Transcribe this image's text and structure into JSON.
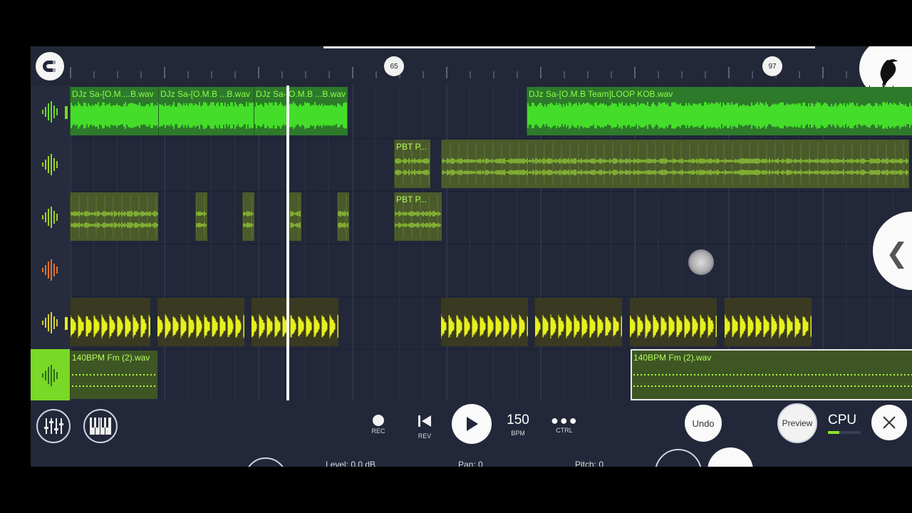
{
  "ruler": {
    "markers": [
      "65",
      "97"
    ]
  },
  "tracks": [
    {
      "icon_color": "#6fd62a",
      "clips": [
        {
          "label": "DJz Sa-[O.M....B.wav",
          "color": "green"
        },
        {
          "label": "DJz Sa-[O.M.B ...B.wav",
          "color": "green"
        },
        {
          "label": "DJz Sa-[O.M.B ...B.wav",
          "color": "green"
        },
        {
          "label": "DJz Sa-[O.M.B Team]LOOP KOB.wav",
          "color": "green"
        }
      ]
    },
    {
      "icon_color": "#9fd02a",
      "clips": [
        {
          "label": "PBT P...",
          "color": "olive"
        },
        {
          "label": "",
          "color": "olive"
        }
      ]
    },
    {
      "icon_color": "#9fd02a",
      "clips": [
        {
          "label": "",
          "color": "olive"
        },
        {
          "label": "PBT P...",
          "color": "olive"
        }
      ]
    },
    {
      "icon_color": "#e0722a",
      "clips": []
    },
    {
      "icon_color": "#d9d02a",
      "clips": []
    },
    {
      "icon_color": "#2f6b1c",
      "clips": [
        {
          "label": "140BPM Fm (2).wav",
          "color": "lime"
        },
        {
          "label": "140BPM Fm (2).wav",
          "color": "lime"
        }
      ]
    }
  ],
  "transport": {
    "rec_label": "REC",
    "rev_label": "REV",
    "bpm_value": "150",
    "bpm_label": "BPM",
    "ctrl_label": "CTRL",
    "undo_label": "Undo",
    "preview_label": "Preview",
    "cpu_label": "CPU"
  },
  "info": {
    "level": "Level: 0.0 dB",
    "pan": "Pan: 0",
    "pitch": "Pitch: 0"
  },
  "colors": {
    "accent_green": "#7ad927",
    "wave_green": "#4cff2a",
    "wave_yellow": "#e6f01e",
    "wave_lime": "#b4ff3a",
    "background": "#22273a"
  }
}
